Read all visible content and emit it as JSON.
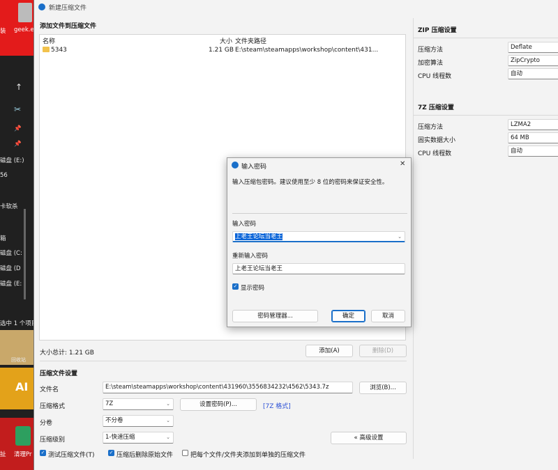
{
  "desktop": {
    "labels": [
      "装",
      "geek.e",
      "磁盘 (E:)",
      "56",
      "卡软杀",
      "箱",
      "磁盘 (C:",
      "磁盘 (D",
      "磁盘 (E:",
      "选中 1 个项目",
      "回收站",
      "AI",
      "扯",
      "清理Pr"
    ]
  },
  "window": {
    "title": "新建压缩文件",
    "add_section": "添加文件到压缩文件",
    "file_list": {
      "columns": [
        "名称",
        "大小",
        "文件夹路径"
      ],
      "rows": [
        {
          "name": "5343",
          "size": "1.21 GB",
          "path": "E:\\steam\\steamapps\\workshop\\content\\431..."
        }
      ]
    },
    "total_size": "大小总计: 1.21 GB",
    "add_button": "添加(A)",
    "delete_button": "删除(D)",
    "settings_section": "压缩文件设置",
    "filename_label": "文件名",
    "filename_value": "E:\\steam\\steamapps\\workshop\\content\\431960\\3556834232\\4562\\5343.7z",
    "browse_button": "浏览(B)...",
    "format_label": "压缩格式",
    "format_value": "7Z",
    "set_password_button": "设置密码(P)...",
    "format_link": "[7Z 格式]",
    "volume_label": "分卷",
    "volume_value": "不分卷",
    "level_label": "压缩级别",
    "level_value": "1-快速压缩",
    "advanced_button": "« 高级设置",
    "opt_test": "测试压缩文件(T)",
    "opt_delete": "压缩后删除原始文件",
    "opt_separate": "把每个文件/文件夹添加到单独的压缩文件",
    "zip_section": "ZIP 压缩设置",
    "zip_method_label": "压缩方法",
    "zip_method_value": "Deflate",
    "zip_encrypt_label": "加密算法",
    "zip_encrypt_value": "ZipCrypto",
    "zip_cpu_label": "CPU 线程数",
    "zip_cpu_value": "自动",
    "sevenz_section": "7Z 压缩设置",
    "sevenz_method_label": "压缩方法",
    "sevenz_method_value": "LZMA2",
    "sevenz_solid_label": "固实数据大小",
    "sevenz_solid_value": "64 MB",
    "sevenz_cpu_label": "CPU 线程数",
    "sevenz_cpu_value": "自动"
  },
  "dialog": {
    "title": "输入密码",
    "message": "输入压缩包密码。建议使用至少 8 位的密码来保证安全性。",
    "password_label": "输入密码",
    "password_value": "上老王论坛当老王",
    "confirm_label": "重新输入密码",
    "confirm_value": "上老王论坛当老王",
    "show_password": "显示密码",
    "manager_button": "密码管理器...",
    "ok_button": "确定",
    "cancel_button": "取消",
    "close_glyph": "✕"
  },
  "colors": {
    "accent": "#1a6fc9",
    "selection": "#0a64d8"
  }
}
